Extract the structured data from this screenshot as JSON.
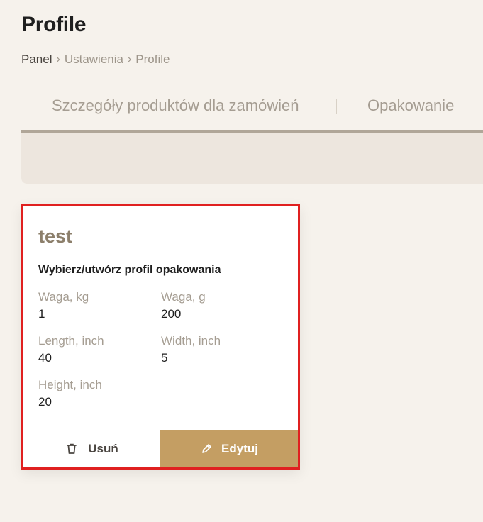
{
  "page": {
    "title": "Profile"
  },
  "breadcrumb": {
    "items": [
      "Panel",
      "Ustawienia",
      "Profile"
    ],
    "separator": "›"
  },
  "tabs": [
    {
      "label": "Szczegóły produktów dla zamówień"
    },
    {
      "label": "Opakowanie"
    }
  ],
  "card": {
    "title": "test",
    "subtitle": "Wybierz/utwórz profil opakowania",
    "fields": {
      "weight_kg": {
        "label": "Waga, kg",
        "value": "1"
      },
      "weight_g": {
        "label": "Waga, g",
        "value": "200"
      },
      "length": {
        "label": "Length, inch",
        "value": "40"
      },
      "width": {
        "label": "Width, inch",
        "value": "5"
      },
      "height": {
        "label": "Height, inch",
        "value": "20"
      }
    },
    "actions": {
      "delete_label": "Usuń",
      "delete_icon": "trash-icon",
      "edit_label": "Edytuj",
      "edit_icon": "pencil-icon"
    }
  },
  "colors": {
    "background": "#f6f2ec",
    "accent": "#c49e63",
    "muted_text": "#a59d92",
    "card_title": "#8c7f6b",
    "highlight_border": "#e02020"
  }
}
